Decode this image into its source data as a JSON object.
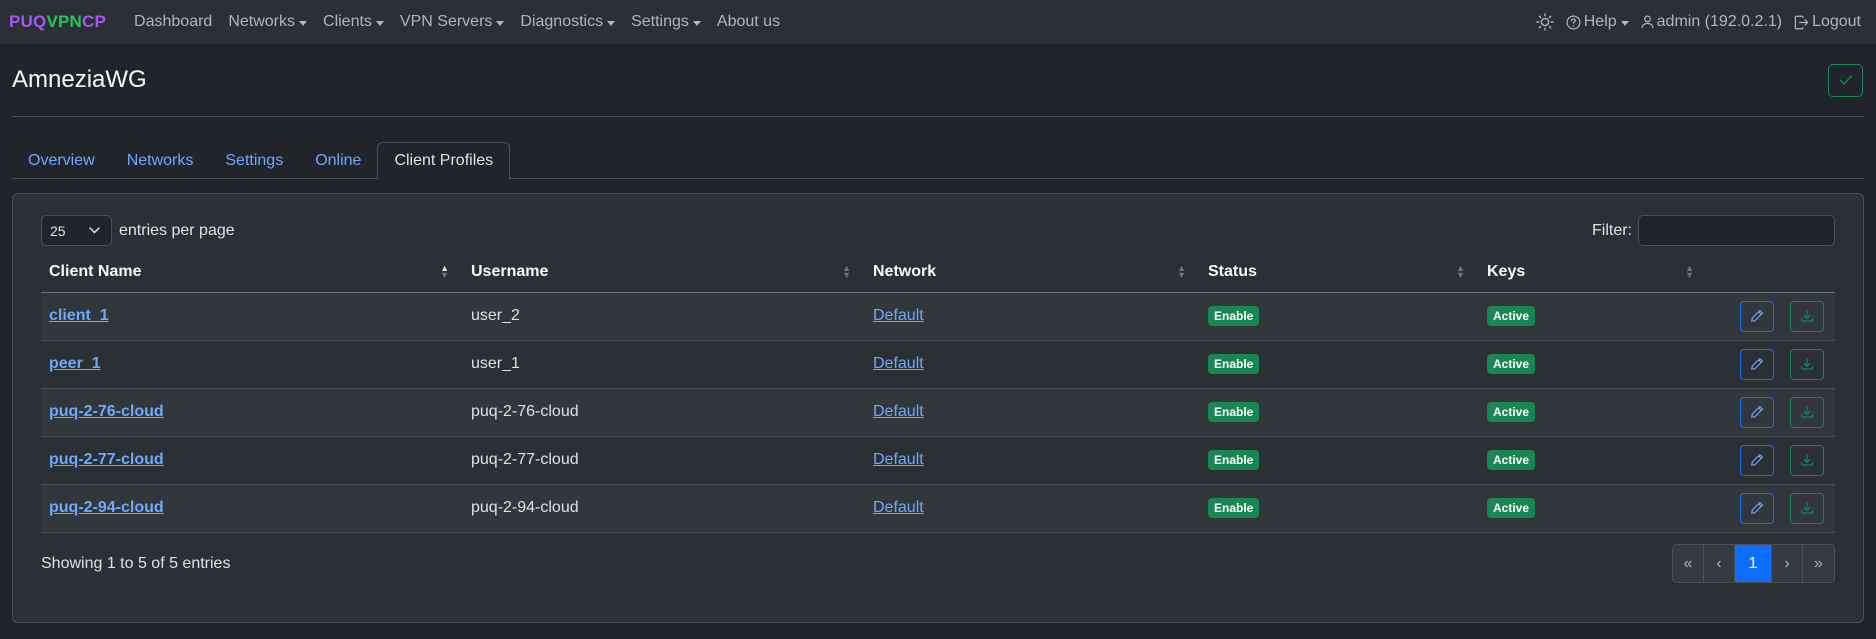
{
  "navbar": {
    "brand_part1": "PUQ",
    "brand_part2": "VPN",
    "brand_part3": "CP",
    "items": [
      {
        "label": "Dashboard",
        "dropdown": false
      },
      {
        "label": "Networks",
        "dropdown": true
      },
      {
        "label": "Clients",
        "dropdown": true
      },
      {
        "label": "VPN Servers",
        "dropdown": true
      },
      {
        "label": "Diagnostics",
        "dropdown": true
      },
      {
        "label": "Settings",
        "dropdown": true
      },
      {
        "label": "About us",
        "dropdown": false
      }
    ],
    "help_label": "Help",
    "user_label": "admin (192.0.2.1)",
    "logout_label": "Logout"
  },
  "page": {
    "title": "AmneziaWG"
  },
  "tabs": [
    "Overview",
    "Networks",
    "Settings",
    "Online",
    "Client Profiles"
  ],
  "active_tab": "Client Profiles",
  "table_controls": {
    "page_size": "25",
    "entries_label": "entries per page",
    "filter_label": "Filter:",
    "filter_value": ""
  },
  "table": {
    "columns": [
      "Client Name",
      "Username",
      "Network",
      "Status",
      "Keys"
    ],
    "rows": [
      {
        "client_name": "client_1",
        "username": "user_2",
        "network": "Default",
        "status": "Enable",
        "keys": "Active"
      },
      {
        "client_name": "peer_1",
        "username": "user_1",
        "network": "Default",
        "status": "Enable",
        "keys": "Active"
      },
      {
        "client_name": "puq-2-76-cloud",
        "username": "puq-2-76-cloud",
        "network": "Default",
        "status": "Enable",
        "keys": "Active"
      },
      {
        "client_name": "puq-2-77-cloud",
        "username": "puq-2-77-cloud",
        "network": "Default",
        "status": "Enable",
        "keys": "Active"
      },
      {
        "client_name": "puq-2-94-cloud",
        "username": "puq-2-94-cloud",
        "network": "Default",
        "status": "Enable",
        "keys": "Active"
      }
    ]
  },
  "footer": {
    "info": "Showing 1 to 5 of 5 entries",
    "pager": [
      "«",
      "‹",
      "1",
      "›",
      "»"
    ],
    "current_page": "1"
  },
  "colors": {
    "background": "#212529",
    "accent": "#0d6efd",
    "success": "#198754",
    "link": "#6ea8fe"
  }
}
